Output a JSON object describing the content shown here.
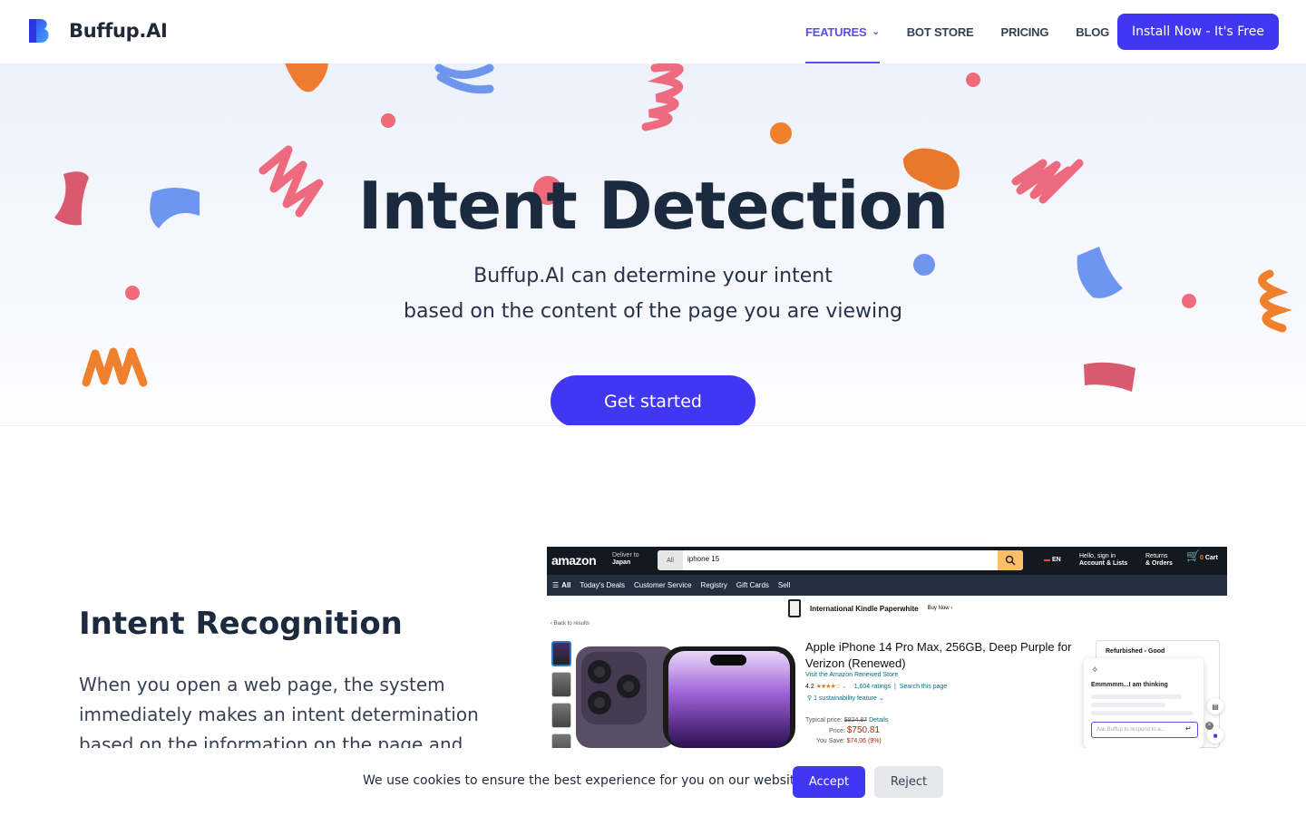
{
  "brand": {
    "name": "Buffup.AI",
    "logo_icon": "buffup-b-logo",
    "accent_color": "#4136f2"
  },
  "nav": {
    "items": [
      {
        "label": "FEATURES",
        "active": true,
        "has_dropdown": true
      },
      {
        "label": "BOT STORE",
        "active": false
      },
      {
        "label": "PRICING",
        "active": false
      },
      {
        "label": "BLOG",
        "active": false
      }
    ],
    "cta_label": "Install Now - It's Free"
  },
  "hero": {
    "title": "Intent Detection",
    "subtitle_line1": "Buffup.AI can determine your intent",
    "subtitle_line2": "based on the content of the page you are viewing",
    "cta_label": "Get started"
  },
  "section": {
    "title": "Intent Recognition",
    "body": "When you open a web page, the system immediately makes an intent determination based on the information on the page and provides three"
  },
  "screenshot": {
    "logo": "amazon",
    "deliver_line1": "Deliver to",
    "deliver_line2": "Japan",
    "search_category": "All",
    "search_query": "iphone 15",
    "lang": "EN",
    "account_line1": "Hello, sign in",
    "account_line2": "Account & Lists",
    "orders_line1": "Returns",
    "orders_line2": "& Orders",
    "cart_count": "0",
    "cart_label": "Cart",
    "subnav": [
      "All",
      "Today's Deals",
      "Customer Service",
      "Registry",
      "Gift Cards",
      "Sell"
    ],
    "kindle_banner": "International Kindle Paperwhite",
    "kindle_buy": "Buy Now ›",
    "back_link": "‹ Back to results",
    "product_title": "Apple iPhone 14 Pro Max, 256GB, Deep Purple for Verizon (Renewed)",
    "store_link": "Visit the Amazon Renewed Store",
    "rating_value": "4.2",
    "rating_count": "1,604 ratings",
    "search_page": "Search this page",
    "sustainability": "1 sustainability feature",
    "typical_label": "Typical price:",
    "typical_price": "$824.87",
    "details": "Details",
    "price_label": "Price:",
    "price": "$750.81",
    "save_label": "You Save:",
    "save_value": "$74.06 (9%)",
    "refurb_label": "Refurbished - Good",
    "thinking": "Emmmmm...I am thinking",
    "ask_placeholder": "Ask Buffup to respond to a..."
  },
  "cookie": {
    "text": "We use cookies to ensure the best experience for you on our website.",
    "accept": "Accept",
    "reject": "Reject"
  }
}
